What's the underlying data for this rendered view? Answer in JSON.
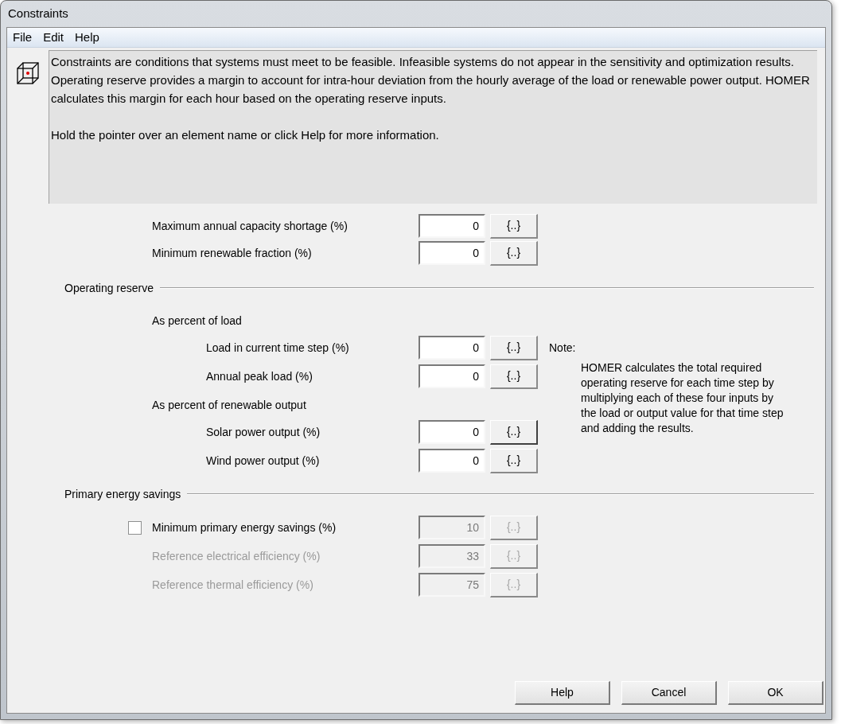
{
  "window": {
    "title": "Constraints"
  },
  "menu": [
    "File",
    "Edit",
    "Help"
  ],
  "info": {
    "paragraphs": [
      "Constraints are conditions that systems must meet to be feasible. Infeasible systems do not appear in the sensitivity and optimization results. Operating reserve provides a margin to account for intra-hour deviation from the hourly average of the load or renewable power output. HOMER calculates this margin for each hour based on the operating reserve inputs.",
      "Hold the pointer over an element name or click Help for more information."
    ]
  },
  "fields": [
    {
      "label": "Maximum annual capacity shortage (%)",
      "value": "0",
      "button": "{..}",
      "disabled": false,
      "focused": false
    },
    {
      "label": "Minimum renewable fraction (%)",
      "value": "0",
      "button": "{..}",
      "disabled": false,
      "focused": false
    }
  ],
  "operating_reserve": {
    "title": "Operating reserve",
    "groups": [
      {
        "title": "As percent of load",
        "fields": [
          {
            "label": "Load in current time step (%)",
            "value": "0",
            "button": "{..}",
            "disabled": false,
            "focused": false
          },
          {
            "label": "Annual peak load (%)",
            "value": "0",
            "button": "{..}",
            "disabled": false,
            "focused": false
          }
        ]
      },
      {
        "title": "As percent of renewable output",
        "fields": [
          {
            "label": "Solar power output (%)",
            "value": "0",
            "button": "{..}",
            "disabled": false,
            "focused": true
          },
          {
            "label": "Wind power output (%)",
            "value": "0",
            "button": "{..}",
            "disabled": false,
            "focused": false
          }
        ]
      }
    ],
    "note": {
      "title": "Note:",
      "text": "HOMER calculates the total required operating reserve for each time step by multiplying each of these four inputs by the load or output value for that time step and adding the results."
    }
  },
  "primary_energy_savings": {
    "title": "Primary energy savings",
    "checkbox": {
      "label": "Minimum primary energy savings (%)",
      "checked": false,
      "value": "10",
      "button": "{..}",
      "disabled": true,
      "focused": false
    },
    "fields": [
      {
        "label": "Reference electrical efficiency (%)",
        "value": "33",
        "button": "{..}",
        "disabled": true,
        "focused": false
      },
      {
        "label": "Reference thermal efficiency (%)",
        "value": "75",
        "button": "{..}",
        "disabled": true,
        "focused": false
      }
    ]
  },
  "buttons": [
    "Help",
    "Cancel",
    "OK"
  ]
}
